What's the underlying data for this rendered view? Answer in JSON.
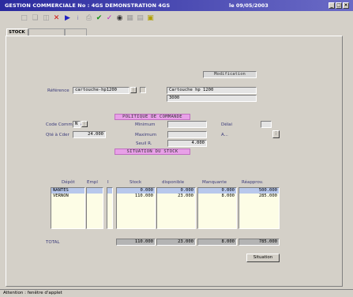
{
  "window": {
    "title": "GESTION COMMERCIALE  No : 4GS  DEMONSTRATION 4GS",
    "date": "le 09/05/2003",
    "minimize": "_",
    "maximize": "□",
    "close": "×"
  },
  "toolbar": {
    "icons": [
      "new-doc-icon",
      "copy-icon",
      "paste-icon",
      "delete-icon",
      "next-icon",
      "info-icon",
      "print-icon",
      "validate-icon",
      "filter-icon",
      "search-icon",
      "calculator-icon",
      "list-icon",
      "export-icon"
    ]
  },
  "tabs": [
    {
      "label": "STOCK",
      "active": true
    },
    {
      "label": "",
      "active": false
    },
    {
      "label": "",
      "active": false
    }
  ],
  "mode": "Modification",
  "reference": {
    "label": "Référence",
    "code": "cartouche-hp1200",
    "designation": "Cartouche  hp 1200",
    "sub": "3000"
  },
  "policy": {
    "title": "POLITIQUE DE COMMANDE",
    "code_commande_label": "Code Commande",
    "code_commande": "N",
    "qte_a_cder_label": "Qté à Cder",
    "qte_a_cder": "24.000",
    "minimum_label": "Minimum",
    "minimum": "",
    "maximum_label": "Maximum",
    "maximum": "",
    "seuil_label": "Seuil R.",
    "seuil": "4.000",
    "delai_label": "Délai",
    "delai": "",
    "a_label": "A...",
    "a_value": ""
  },
  "situation": {
    "title": "SITUATION DU STOCK",
    "headers": {
      "depot": "Dépôt",
      "empl": "Empl",
      "i": "I",
      "stock": "Stock",
      "disponible": "disponible",
      "manquante": "Manquante",
      "reapprov": "Réapprov."
    },
    "rows": [
      {
        "depot": "NANTES",
        "empl": "",
        "i": "",
        "stock": "0.000",
        "disponible": "0.000",
        "manquante": "0.000",
        "reapprov": "500.000"
      },
      {
        "depot": "VERNON",
        "empl": "",
        "i": "",
        "stock": "110.000",
        "disponible": "23.000",
        "manquante": "8.000",
        "reapprov": "285.000"
      }
    ],
    "total_label": "TOTAL",
    "totals": {
      "stock": "110.000",
      "disponible": "23.000",
      "manquante": "8.000",
      "reapprov": "785.000"
    }
  },
  "buttons": {
    "situation": "Situation"
  },
  "status": "Attention : fenêtre d'applet"
}
